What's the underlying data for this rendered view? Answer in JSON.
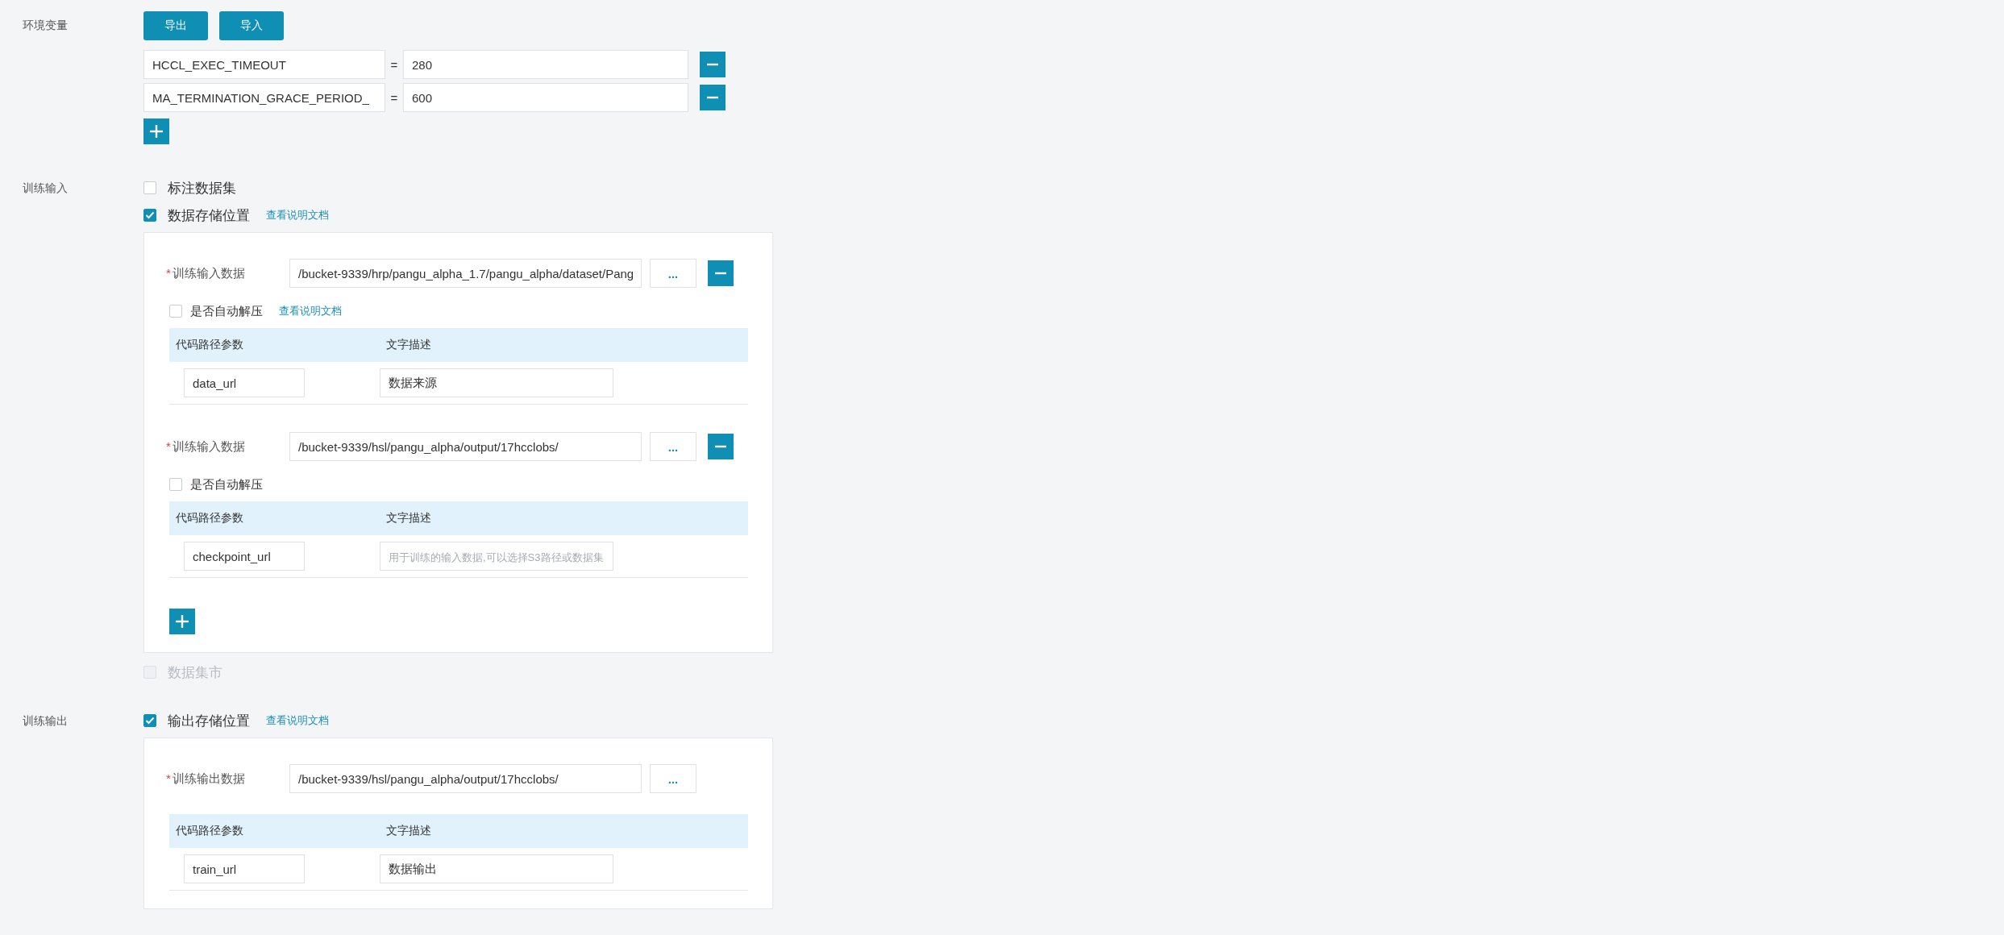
{
  "sections": [
    {
      "kind": "env",
      "label": "环境变量",
      "buttons": [
        "导出",
        "导入"
      ],
      "separator": "=",
      "rows": [
        {
          "key": "HCCL_EXEC_TIMEOUT",
          "value": "280"
        },
        {
          "key": "MA_TERMINATION_GRACE_PERIOD_",
          "value": "600"
        }
      ],
      "can_add": true
    },
    {
      "kind": "options",
      "label": "训练输入",
      "options": [
        {
          "label": "标注数据集",
          "checked": false,
          "disabled": false
        },
        {
          "label": "数据存储位置",
          "checked": true,
          "disabled": false,
          "link": "查看说明文档",
          "card": {
            "can_add": true,
            "entries": [
              {
                "label": "训练输入数据",
                "required_mark": "*",
                "path": "/bucket-9339/hrp/pangu_alpha_1.7/pangu_alpha/dataset/Pang",
                "browse": "...",
                "removable": true,
                "unzip": {
                  "label": "是否自动解压",
                  "checked": false,
                  "link": "查看说明文档"
                },
                "columns": [
                  "代码路径参数",
                  "文字描述"
                ],
                "param": "data_url",
                "description": {
                  "value": "数据来源"
                }
              },
              {
                "label": "训练输入数据",
                "required_mark": "*",
                "path": "/bucket-9339/hsl/pangu_alpha/output/17hcclobs/",
                "browse": "...",
                "removable": true,
                "unzip": {
                  "label": "是否自动解压",
                  "checked": false
                },
                "columns": [
                  "代码路径参数",
                  "文字描述"
                ],
                "param": "checkpoint_url",
                "description": {
                  "placeholder": "用于训练的输入数据,可以选择S3路径或数据集"
                }
              }
            ]
          }
        },
        {
          "label": "数据集市",
          "checked": false,
          "disabled": true
        }
      ]
    },
    {
      "kind": "options",
      "label": "训练输出",
      "options": [
        {
          "label": "输出存储位置",
          "checked": true,
          "disabled": false,
          "link": "查看说明文档",
          "card": {
            "can_add": false,
            "entries": [
              {
                "label": "训练输出数据",
                "required_mark": "*",
                "path": "/bucket-9339/hsl/pangu_alpha/output/17hcclobs/",
                "browse": "...",
                "removable": false,
                "columns": [
                  "代码路径参数",
                  "文字描述"
                ],
                "param": "train_url",
                "description": {
                  "value": "数据输出"
                }
              }
            ]
          }
        }
      ]
    }
  ]
}
